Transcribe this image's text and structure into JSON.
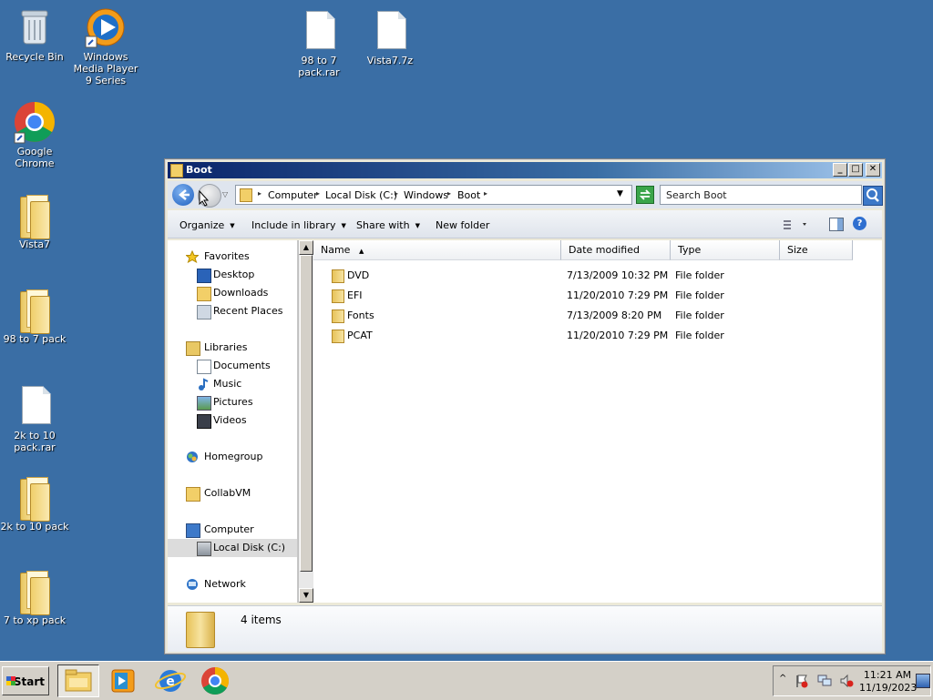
{
  "desktop": {
    "icons": [
      {
        "label": "Recycle Bin"
      },
      {
        "label": "Windows Media Player 9 Series"
      },
      {
        "label": "98 to 7 pack.rar"
      },
      {
        "label": "Vista7.7z"
      },
      {
        "label": "Google Chrome"
      },
      {
        "label": "Vista7"
      },
      {
        "label": "98 to 7 pack"
      },
      {
        "label": "2k to 10 pack.rar"
      },
      {
        "label": "2k to 10 pack"
      },
      {
        "label": "7 to xp pack"
      }
    ]
  },
  "window": {
    "title": "Boot",
    "breadcrumbs": [
      "Computer",
      "Local Disk (C:)",
      "Windows",
      "Boot"
    ],
    "search_placeholder": "Search Boot",
    "toolbar": {
      "organize": "Organize",
      "include": "Include in library",
      "share": "Share with",
      "new_folder": "New folder"
    },
    "nav": {
      "favorites": "Favorites",
      "desktop": "Desktop",
      "downloads": "Downloads",
      "recent": "Recent Places",
      "libraries": "Libraries",
      "documents": "Documents",
      "music": "Music",
      "pictures": "Pictures",
      "videos": "Videos",
      "homegroup": "Homegroup",
      "collabvm": "CollabVM",
      "computer": "Computer",
      "localdisk": "Local Disk (C:)",
      "network": "Network"
    },
    "columns": [
      "Name",
      "Date modified",
      "Type",
      "Size"
    ],
    "files": [
      {
        "name": "DVD",
        "date": "7/13/2009 10:32 PM",
        "type": "File folder"
      },
      {
        "name": "EFI",
        "date": "11/20/2010 7:29 PM",
        "type": "File folder"
      },
      {
        "name": "Fonts",
        "date": "7/13/2009 8:20 PM",
        "type": "File folder"
      },
      {
        "name": "PCAT",
        "date": "11/20/2010 7:29 PM",
        "type": "File folder"
      }
    ],
    "status": "4 items"
  },
  "taskbar": {
    "start_label": "Start",
    "time": "11:21 AM",
    "date": "11/19/2023"
  },
  "colors": {
    "desktop": "#3a6ea5",
    "title_start": "#0a246a",
    "face": "#d4d0c8"
  }
}
